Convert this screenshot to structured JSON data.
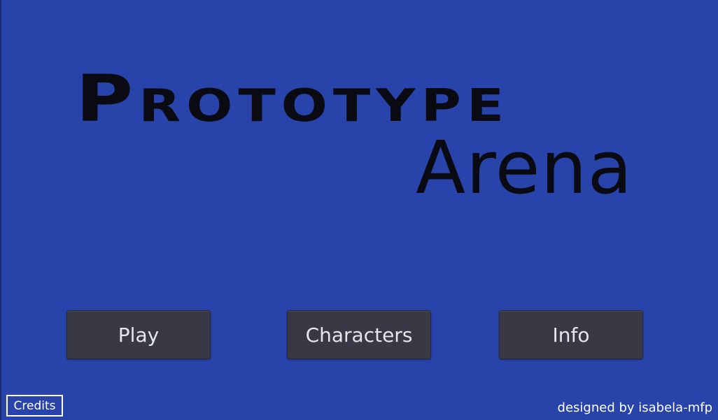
{
  "title": {
    "line1": "Prototype",
    "line2": "Arena"
  },
  "menu": {
    "play_label": "Play",
    "characters_label": "Characters",
    "info_label": "Info"
  },
  "footer": {
    "credits_label": "Credits",
    "designer_text": "designed by isabela-mfp"
  },
  "colors": {
    "background": "#2843aa",
    "button_bg": "#393845",
    "button_text": "#e6e6ea",
    "title_text": "#0a0a12",
    "footer_text": "#ffffff"
  }
}
